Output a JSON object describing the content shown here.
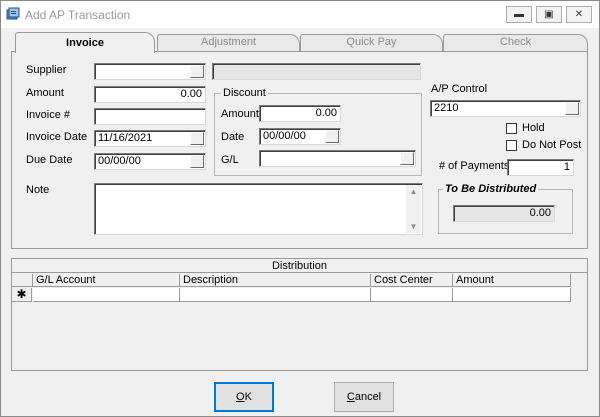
{
  "window": {
    "title": "Add AP Transaction",
    "minimize_glyph": "▬",
    "restore_glyph": "▣",
    "close_glyph": "✕",
    "icon": "ap-app-icon"
  },
  "tabs": [
    {
      "label": "Invoice",
      "active": true
    },
    {
      "label": "Adjustment",
      "active": false
    },
    {
      "label": "Quick Pay",
      "active": false
    },
    {
      "label": "Check",
      "active": false
    }
  ],
  "invoice": {
    "supplier_label": "Supplier",
    "supplier_value": "",
    "supplier_name_value": "",
    "amount_label": "Amount",
    "amount_value": "0.00",
    "invoice_no_label": "Invoice #",
    "invoice_no_value": "",
    "invoice_date_label": "Invoice Date",
    "invoice_date_value": "11/16/2021",
    "due_date_label": "Due Date",
    "due_date_value": "00/00/00",
    "note_label": "Note",
    "note_value": ""
  },
  "discount": {
    "group_title": "Discount",
    "amount_label": "Amount",
    "amount_value": "0.00",
    "date_label": "Date",
    "date_value": "00/00/00",
    "gl_label": "G/L",
    "gl_value": ""
  },
  "ap_control": {
    "label": "A/P Control",
    "value": "2210",
    "hold_label": "Hold",
    "hold_checked": false,
    "do_not_post_label": "Do Not Post",
    "do_not_post_checked": false,
    "payments_label": "# of Payments",
    "payments_value": "1"
  },
  "to_be_distributed": {
    "title": "To Be Distributed",
    "value": "0.00"
  },
  "distribution": {
    "caption": "Distribution",
    "columns": [
      "G/L Account",
      "Description",
      "Cost Center",
      "Amount"
    ],
    "new_row_marker": "✱",
    "rows": []
  },
  "buttons": {
    "ok_label": "K",
    "ok_mnemonic": "O",
    "cancel_label": "ancel",
    "cancel_mnemonic": "C"
  },
  "icons": {
    "scroll_up": "▲",
    "scroll_down": "▼"
  },
  "colors": {
    "accent": "#0078d7",
    "title_text": "#9a9a9a"
  }
}
